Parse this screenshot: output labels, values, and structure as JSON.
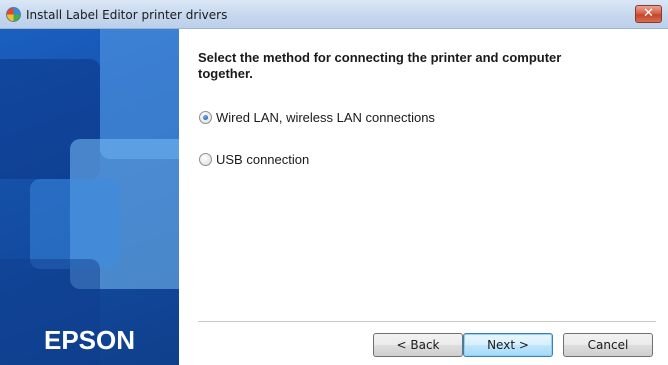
{
  "window": {
    "title": "Install Label Editor printer drivers",
    "close_glyph": "✕"
  },
  "brand": {
    "logo_text": "EPSON",
    "accent_color": "#1550a8"
  },
  "content": {
    "instruction": "Select the method for connecting the printer and computer together.",
    "options": [
      {
        "label": "Wired LAN, wireless LAN connections",
        "selected": true
      },
      {
        "label": "USB connection",
        "selected": false
      }
    ]
  },
  "buttons": {
    "back": "< Back",
    "next": "Next >",
    "cancel": "Cancel"
  },
  "icons": {
    "app": "app-icon",
    "close": "close-icon"
  }
}
